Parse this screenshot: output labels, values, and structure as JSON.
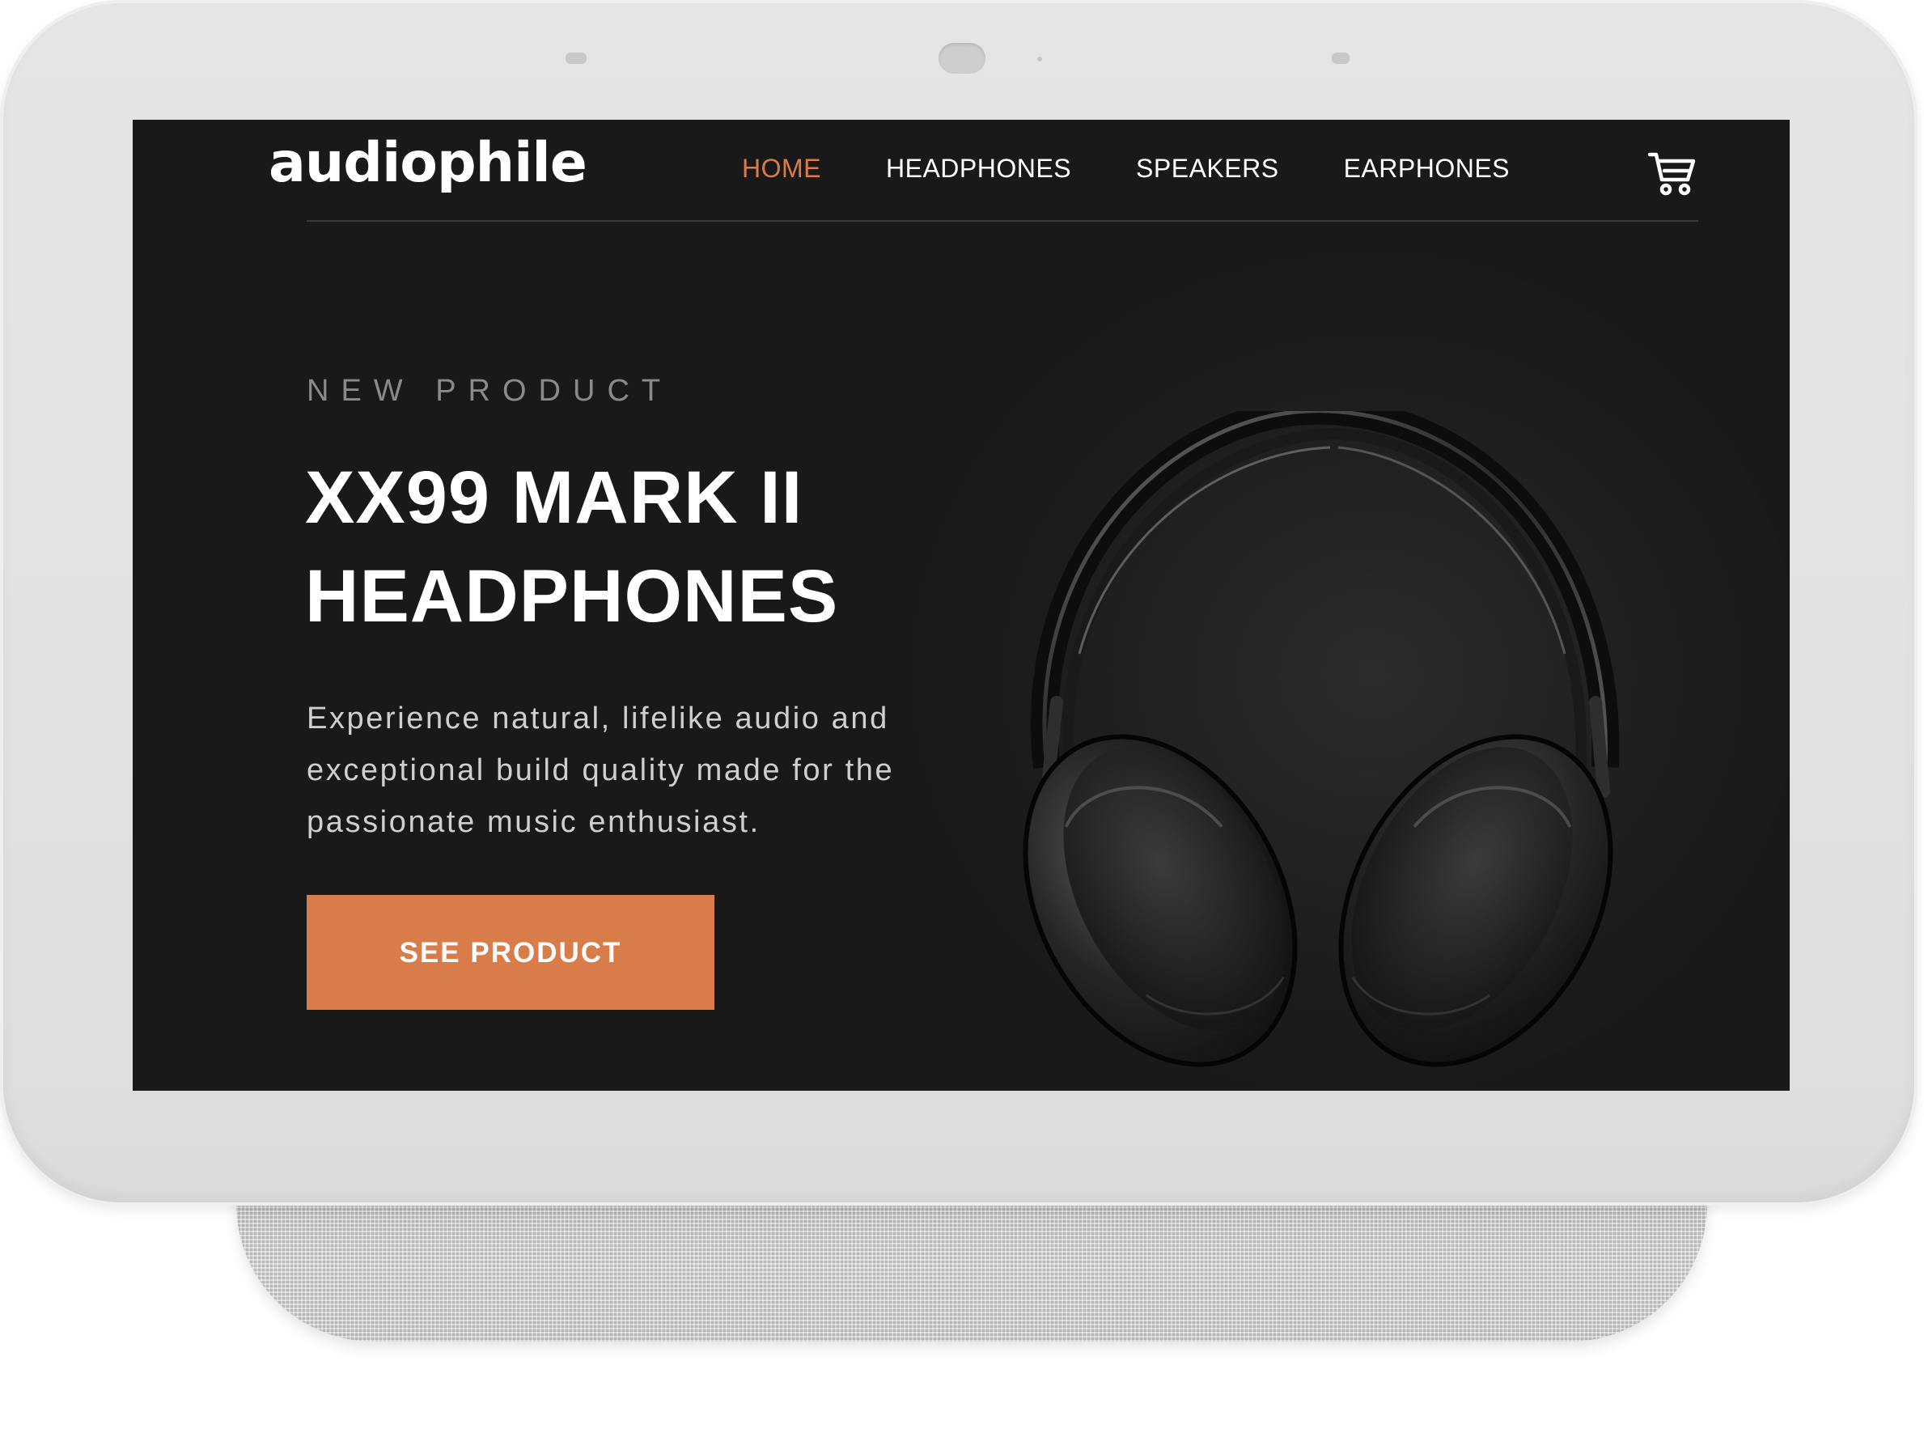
{
  "device": {
    "type": "smart display"
  },
  "colors": {
    "accent": "#d87d4a",
    "screen_background": "#191919",
    "text_primary": "#ffffff",
    "text_muted": "#8a8a8a",
    "bezel": "#e3e2e0",
    "stand_fabric": "#cfcecc"
  },
  "header": {
    "logo": "audiophile",
    "nav": [
      {
        "label": "HOME",
        "active": true
      },
      {
        "label": "HEADPHONES",
        "active": false
      },
      {
        "label": "SPEAKERS",
        "active": false
      },
      {
        "label": "EARPHONES",
        "active": false
      }
    ],
    "cart_icon": "cart-icon"
  },
  "hero": {
    "overline": "NEW PRODUCT",
    "title_line1": "XX99 MARK II",
    "title_line2": "HEADPHONES",
    "description": "Experience natural, lifelike audio and exceptional build quality made for the passionate music enthusiast.",
    "cta_label": "SEE PRODUCT",
    "image": "headphones-image"
  }
}
